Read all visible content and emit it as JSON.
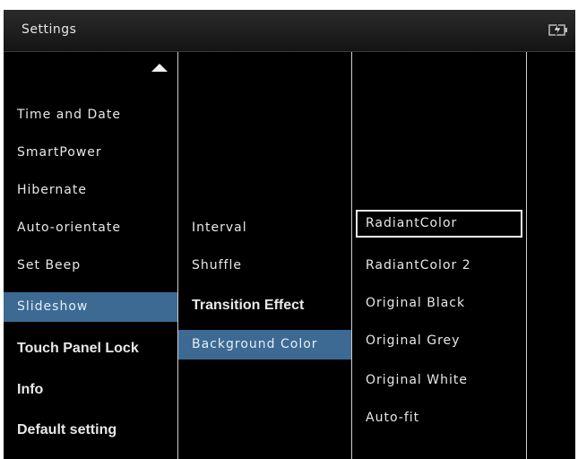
{
  "header": {
    "title": "Settings",
    "battery_icon": "battery-charging-icon"
  },
  "menu1": {
    "scroll_up_icon": "up-arrow-icon",
    "items": [
      {
        "label": "Time and Date"
      },
      {
        "label": "SmartPower"
      },
      {
        "label": "Hibernate"
      },
      {
        "label": "Auto-orientate"
      },
      {
        "label": "Set Beep"
      },
      {
        "label": "Slideshow"
      },
      {
        "label": "Touch Panel Lock"
      },
      {
        "label": "Info"
      },
      {
        "label": "Default setting"
      }
    ],
    "selected": "Slideshow"
  },
  "menu2": {
    "items": [
      {
        "label": "Interval"
      },
      {
        "label": "Shuffle"
      },
      {
        "label": "Transition Effect"
      },
      {
        "label": "Background Color"
      }
    ],
    "selected": "Background Color"
  },
  "menu3": {
    "items": [
      {
        "label": "RadiantColor"
      },
      {
        "label": "RadiantColor 2"
      },
      {
        "label": "Original Black"
      },
      {
        "label": "Original Grey"
      },
      {
        "label": "Original White"
      },
      {
        "label": "Auto-fit"
      }
    ],
    "focused": "RadiantColor"
  },
  "colors": {
    "selection": "#3c6a93",
    "text": "#e8e8e8",
    "background": "#000000"
  }
}
